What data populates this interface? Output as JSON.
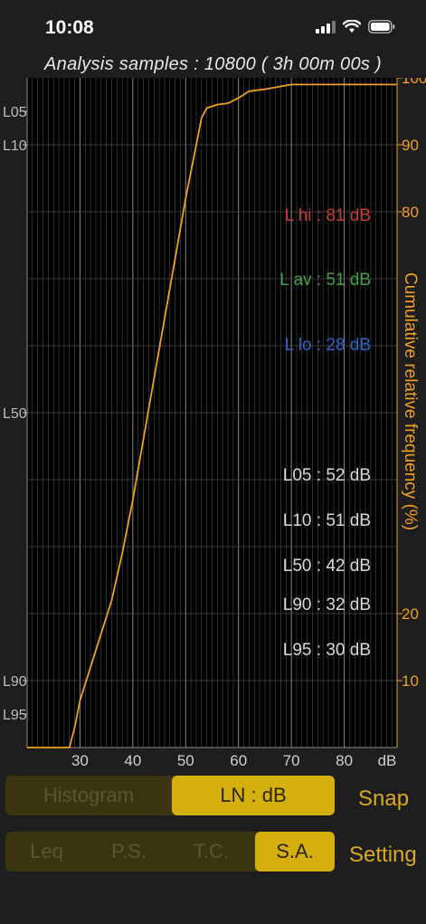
{
  "status_bar": {
    "time": "10:08"
  },
  "header": {
    "subtitle": "Analysis samples : 10800 ( 3h 00m 00s )"
  },
  "colors": {
    "accent": "#f0a020",
    "bg": "#1e1e1e",
    "plot_bg": "#000000",
    "hi": "#c83c32",
    "av": "#3fa046",
    "lo": "#2d64c8",
    "toggle_active": "#d4af0d"
  },
  "chart_data": {
    "type": "line",
    "series": [
      {
        "x": [
          20,
          28,
          29,
          30,
          32,
          34,
          36,
          38,
          40,
          42,
          44,
          46,
          48,
          50,
          52,
          53,
          54,
          56,
          58,
          60,
          62,
          65,
          70,
          80,
          90
        ],
        "y": [
          0,
          0,
          3,
          7,
          12,
          17,
          22,
          29,
          37,
          46,
          55,
          64,
          73,
          82,
          90,
          94,
          95.5,
          96,
          96.2,
          97,
          98,
          98.3,
          99,
          99,
          99
        ]
      }
    ],
    "xlim": [
      20,
      90
    ],
    "ylim": [
      0,
      100
    ],
    "x_ticks": [
      "30",
      "40",
      "50",
      "60",
      "70",
      "80",
      "dB"
    ],
    "y_right_ticks": [
      10,
      20,
      80,
      90,
      100
    ],
    "y_right_label": "Cumulative relative frequency (%)",
    "left_markers": [
      {
        "label": "L05",
        "pct": 95
      },
      {
        "label": "L10",
        "pct": 90
      },
      {
        "label": "L50",
        "pct": 50
      },
      {
        "label": "L90",
        "pct": 10
      },
      {
        "label": "L95",
        "pct": 5
      }
    ],
    "stats": {
      "hi": "L hi : 81 dB",
      "av": "L av : 51 dB",
      "lo": "L lo : 28 dB",
      "l05": "L05 : 52 dB",
      "l10": "L10 : 51 dB",
      "l50": "L50 : 42 dB",
      "l90": "L90 : 32 dB",
      "l95": "L95 : 30 dB"
    }
  },
  "toggle_top": {
    "options": [
      "Histogram",
      "LN : dB"
    ],
    "selected": "LN : dB"
  },
  "toggle_bottom": {
    "options": [
      "Leq",
      "P.S.",
      "T.C.",
      "S.A."
    ],
    "selected": "S.A."
  },
  "buttons": {
    "snap": "Snap",
    "setting": "Setting"
  }
}
